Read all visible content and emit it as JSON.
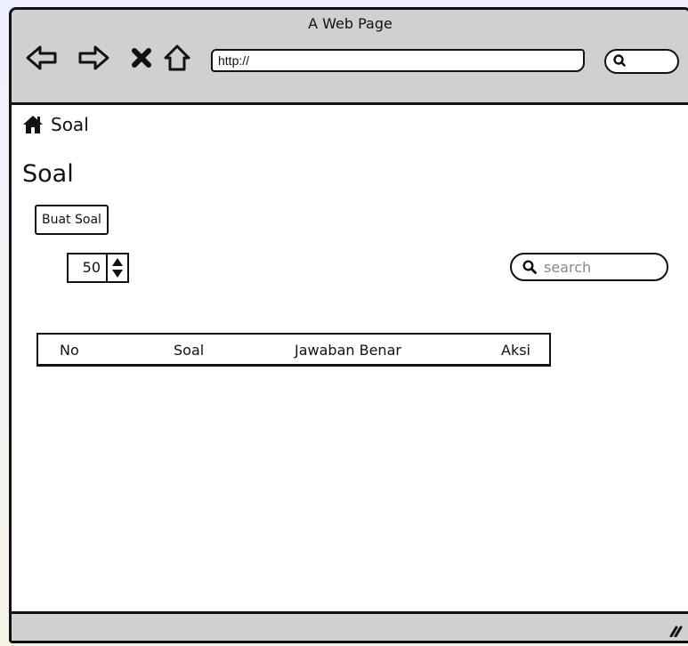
{
  "window": {
    "title": "A Web Page"
  },
  "browser": {
    "url": "http://",
    "icons": {
      "back": "back-arrow-icon",
      "forward": "forward-arrow-icon",
      "stop": "close-icon",
      "home": "home-icon",
      "search": "search-icon"
    }
  },
  "breadcrumb": {
    "icon": "home-icon",
    "label": "Soal"
  },
  "page": {
    "title": "Soal"
  },
  "toolbar": {
    "create_label": "Buat Soal"
  },
  "paging": {
    "rows_per_page": "50"
  },
  "search": {
    "placeholder": "search"
  },
  "table": {
    "columns": [
      "No",
      "Soal",
      "Jawaban Benar",
      "Aksi"
    ],
    "rows": []
  },
  "colors": {
    "chrome": "#d0d0d0",
    "border": "#111111",
    "background": "#ffffff"
  }
}
